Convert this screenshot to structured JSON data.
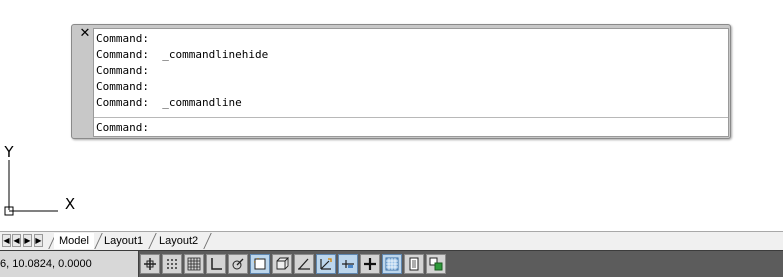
{
  "command_window": {
    "close_glyph": "✕",
    "history": [
      "Command:",
      "Command:  _commandlinehide",
      "Command:",
      "Command:",
      "Command:  _commandline"
    ],
    "prompt": "Command:"
  },
  "ucs": {
    "x_label": "X",
    "y_label": "Y"
  },
  "layout_tabs": {
    "nav_buttons": [
      "◀",
      "◀",
      "▶",
      "▶"
    ],
    "tabs": [
      "Model",
      "Layout1",
      "Layout2"
    ],
    "active": "Model"
  },
  "status_bar": {
    "coordinates": "6, 10.0824, 0.0000",
    "toggle_icons": [
      "infer-constraints-icon",
      "snap-mode-icon",
      "grid-display-icon",
      "ortho-mode-icon",
      "polar-tracking-icon",
      "object-snap-icon",
      "3d-object-snap-icon",
      "object-snap-tracking-icon",
      "dynamic-ucs-icon",
      "dynamic-input-icon",
      "lineweight-icon",
      "transparency-icon",
      "quick-properties-icon",
      "selection-cycling-icon"
    ]
  }
}
